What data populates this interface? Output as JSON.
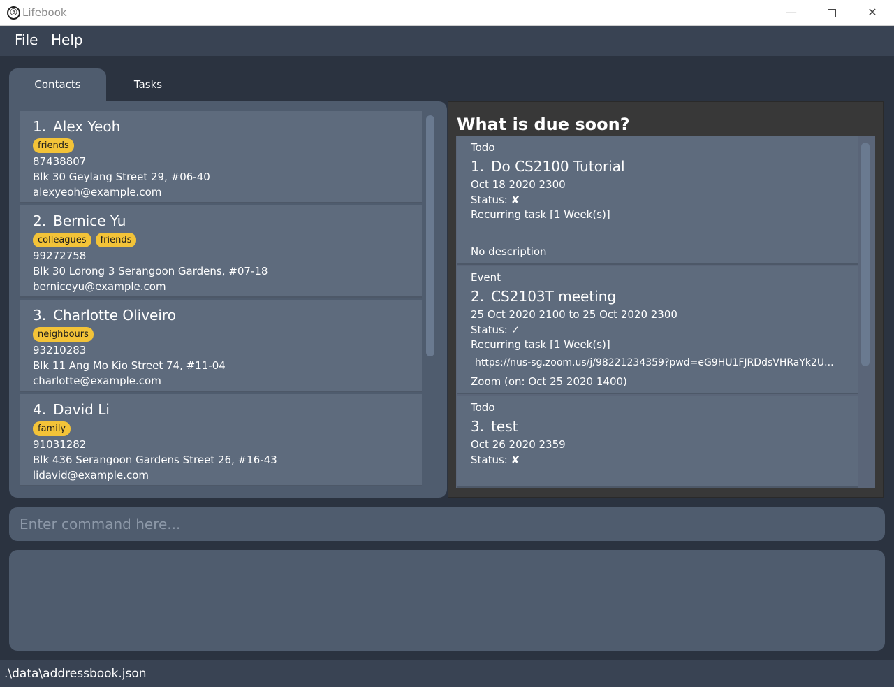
{
  "window": {
    "title": "Lifebook",
    "icon_glyph": "ⓑ",
    "minimize_glyph": "—",
    "close_glyph": "✕"
  },
  "menu": {
    "file": "File",
    "help": "Help"
  },
  "tabs": {
    "contacts": "Contacts",
    "tasks": "Tasks"
  },
  "contacts": [
    {
      "index": "1.",
      "name": "Alex Yeoh",
      "tags": [
        "friends"
      ],
      "phone": "87438807",
      "address": "Blk 30 Geylang Street 29, #06-40",
      "email": "alexyeoh@example.com"
    },
    {
      "index": "2.",
      "name": "Bernice Yu",
      "tags": [
        "colleagues",
        "friends"
      ],
      "phone": "99272758",
      "address": "Blk 30 Lorong 3 Serangoon Gardens, #07-18",
      "email": "berniceyu@example.com"
    },
    {
      "index": "3.",
      "name": "Charlotte Oliveiro",
      "tags": [
        "neighbours"
      ],
      "phone": "93210283",
      "address": "Blk 11 Ang Mo Kio Street 74, #11-04",
      "email": "charlotte@example.com"
    },
    {
      "index": "4.",
      "name": "David Li",
      "tags": [
        "family"
      ],
      "phone": "91031282",
      "address": "Blk 436 Serangoon Gardens Street 26, #16-43",
      "email": "lidavid@example.com"
    }
  ],
  "tasks_panel": {
    "heading": "What is due soon?",
    "tasks": [
      {
        "type": "Todo",
        "index": "1.",
        "name": "Do CS2100 Tutorial",
        "date": "Oct 18 2020 2300",
        "status": "Status: ✘",
        "recurring": "Recurring task [1 Week(s)]",
        "description": "No description"
      },
      {
        "type": "Event",
        "index": "2.",
        "name": "CS2103T meeting",
        "date": "25 Oct 2020 2100 to 25 Oct 2020 2300",
        "status": "Status: ✓",
        "recurring": "Recurring task [1 Week(s)]",
        "link": "https://nus-sg.zoom.us/j/98221234359?pwd=eG9HU1FJRDdsVHRaYk2U...",
        "zoom": "Zoom (on: Oct 25 2020 1400)"
      },
      {
        "type": "Todo",
        "index": "3.",
        "name": "test",
        "date": "Oct 26 2020 2359",
        "status": "Status: ✘"
      }
    ]
  },
  "command": {
    "placeholder": "Enter command here..."
  },
  "status_bar": {
    "path": ".\\data\\addressbook.json"
  },
  "colors": {
    "tag": "#f3c338",
    "panel": "#4f5c6e",
    "card": "#5e6b7d",
    "background": "#2b3340"
  }
}
